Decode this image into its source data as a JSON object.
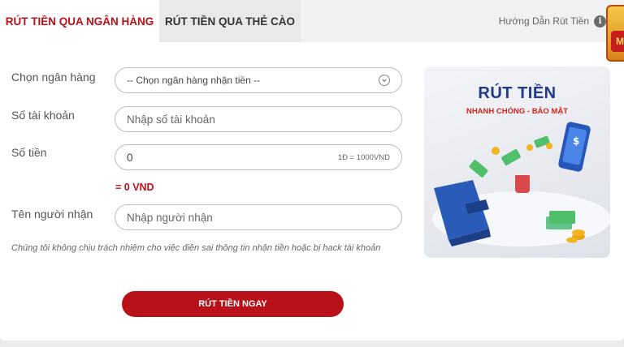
{
  "tabs": {
    "bank_withdraw": "RÚT TIỀN QUA NGÂN HÀNG",
    "card_withdraw": "RÚT TIỀN QUA THẺ CÀO",
    "guide": "Hướng Dẫn Rút Tiền"
  },
  "form": {
    "bank_label": "Chọn ngân hàng",
    "bank_select_value": "-- Chọn ngân hàng nhận tiền --",
    "account_label": "Số tài khoản",
    "account_placeholder": "Nhập số tài khoản",
    "amount_label": "Số tiền",
    "amount_value": "0",
    "amount_rate": "1Đ = 1000VND",
    "amount_equivalent": "= 0 VND",
    "recipient_label": "Tên người nhận",
    "recipient_placeholder": "Nhập người nhận",
    "disclaimer": "Chúng tôi không chịu trách nhiệm cho việc điền sai thông tin nhận tiền hoặc bị hack tài khoản",
    "submit_label": "RÚT TIỀN NGAY"
  },
  "banner": {
    "title": "RÚT TIỀN",
    "subtitle": "NHANH CHÓNG - BẢO MẬT"
  },
  "icons": [
    "info-icon",
    "chevron-down-icon",
    "wallet-icon",
    "phone-icon",
    "money-icon",
    "coin-icon"
  ],
  "colors": {
    "accent": "#b8111a",
    "banner_title": "#1f3a8c"
  }
}
